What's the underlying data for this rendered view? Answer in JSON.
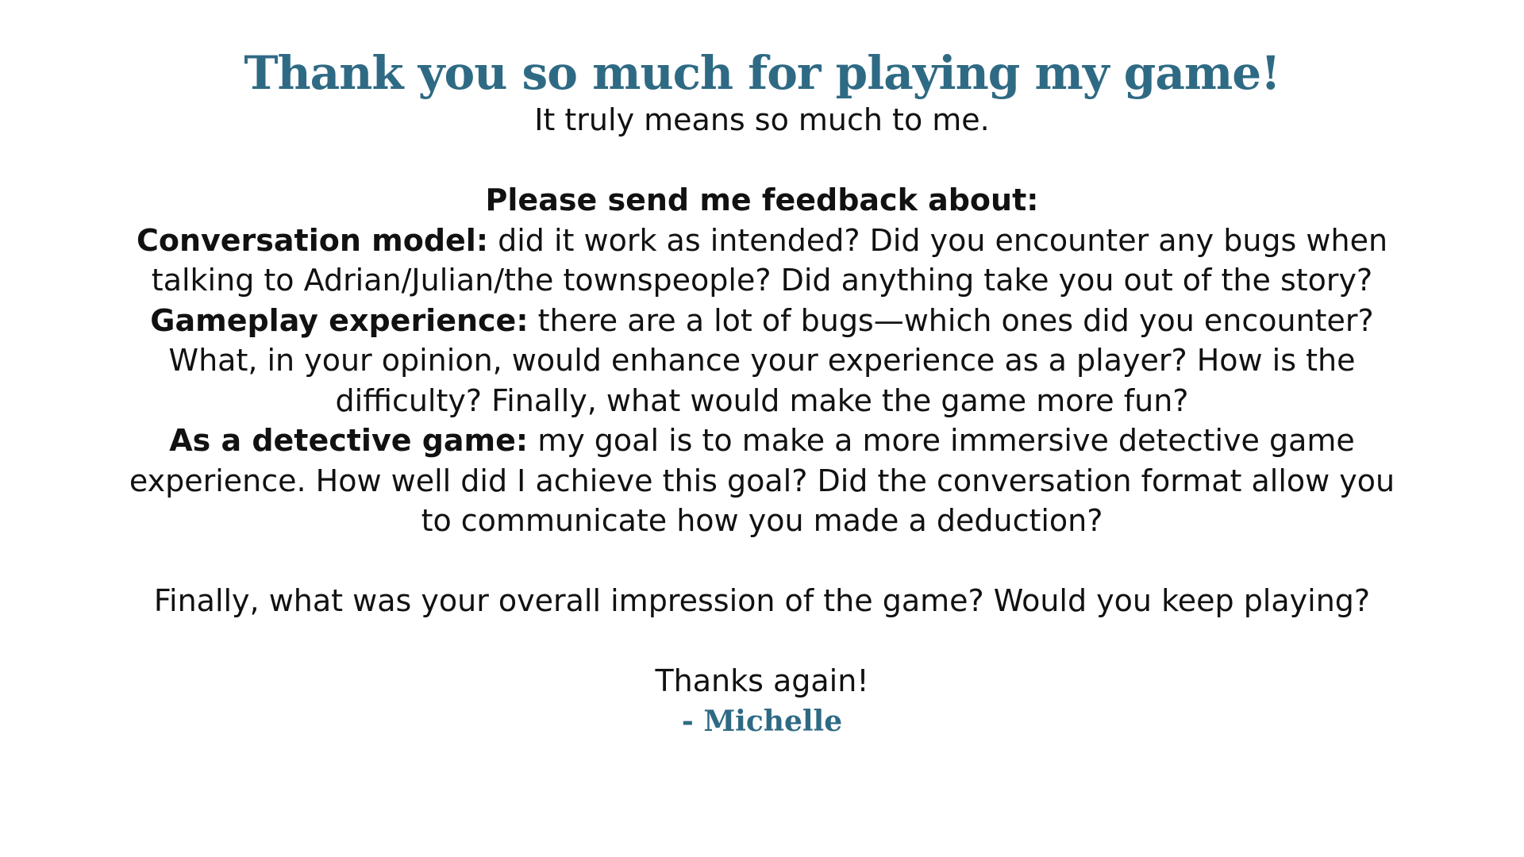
{
  "colors": {
    "accent": "#2f6a84",
    "text": "#111111",
    "background": "#ffffff"
  },
  "title": "Thank you so much for playing my game!",
  "intro": "It truly means so much to me.",
  "feedback": {
    "heading": "Please send me feedback about:",
    "conversation_label": "Conversation model:",
    "conversation_text": " did it work as intended? Did you encounter any bugs when talking to Adrian/Julian/the townspeople? Did anything take you out of the story?",
    "gameplay_label": "Gameplay experience:",
    "gameplay_text": " there are a lot of bugs—which ones did you encounter? What, in your opinion, would enhance your experience as a player? How is the difficulty? Finally, what would make the game more fun?",
    "detective_label": "As a detective game:",
    "detective_text": " my goal is to make a more immersive detective game experience. How well did I achieve this goal? Did the conversation format allow you to communicate how you made a deduction?"
  },
  "overall_question": "Finally, what was your overall impression of the game? Would you keep playing?",
  "thanks": "Thanks again!",
  "signature": "- Michelle"
}
